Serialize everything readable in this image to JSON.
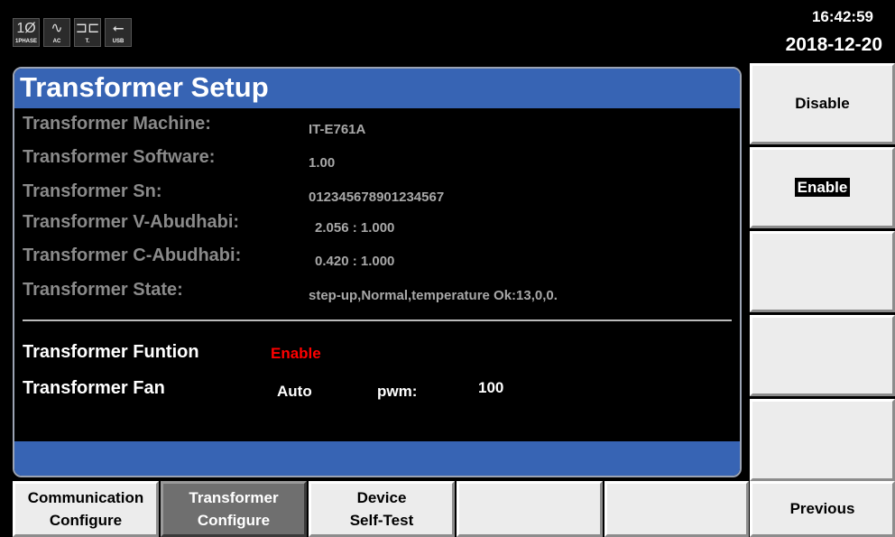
{
  "status_bar": {
    "icons": [
      {
        "name": "1phase-icon",
        "glyph": "1Ø",
        "caption": "1PHASE"
      },
      {
        "name": "ac-icon",
        "glyph": "∿",
        "caption": "AC"
      },
      {
        "name": "transformer-icon",
        "glyph": "⊐⊏",
        "caption": "T."
      },
      {
        "name": "usb-icon",
        "glyph": "⭠",
        "caption": "USB"
      }
    ],
    "time": "16:42:59",
    "date": "2018-12-20"
  },
  "panel": {
    "title": "Transformer Setup",
    "rows": [
      {
        "label": "Transformer Machine:",
        "value": "IT-E761A"
      },
      {
        "label": "Transformer Software:",
        "value": "1.00"
      },
      {
        "label": "Transformer Sn:",
        "value": "012345678901234567"
      },
      {
        "label": "Transformer V-Abudhabi:",
        "value": "2.056 : 1.000"
      },
      {
        "label": "Transformer C-Abudhabi:",
        "value": "0.420 : 1.000"
      },
      {
        "label": "Transformer State:",
        "value": "step-up,Normal,temperature Ok:13,0,0."
      }
    ],
    "function": {
      "label": "Transformer Funtion",
      "value": "Enable",
      "value_color": "#ff0000"
    },
    "fan": {
      "label": "Transformer Fan",
      "mode": "Auto",
      "pwm_label": "pwm:",
      "pwm_value": "100"
    }
  },
  "softkeys": [
    {
      "label": "Disable",
      "selected": false
    },
    {
      "label": "Enable",
      "selected": true
    },
    {
      "label": ""
    },
    {
      "label": ""
    },
    {
      "label": ""
    }
  ],
  "function_keys": [
    {
      "line1": "Communication",
      "line2": "Configure",
      "active": false
    },
    {
      "line1": "Transformer",
      "line2": "Configure",
      "active": true
    },
    {
      "line1": "Device",
      "line2": "Self-Test",
      "active": false
    },
    {
      "line1": "",
      "line2": ""
    },
    {
      "line1": "",
      "line2": ""
    },
    {
      "label": "Previous"
    }
  ],
  "colors": {
    "title_bar": "#3764b4",
    "active_key": "#6f6f6f",
    "enable_text": "#ff0000"
  }
}
